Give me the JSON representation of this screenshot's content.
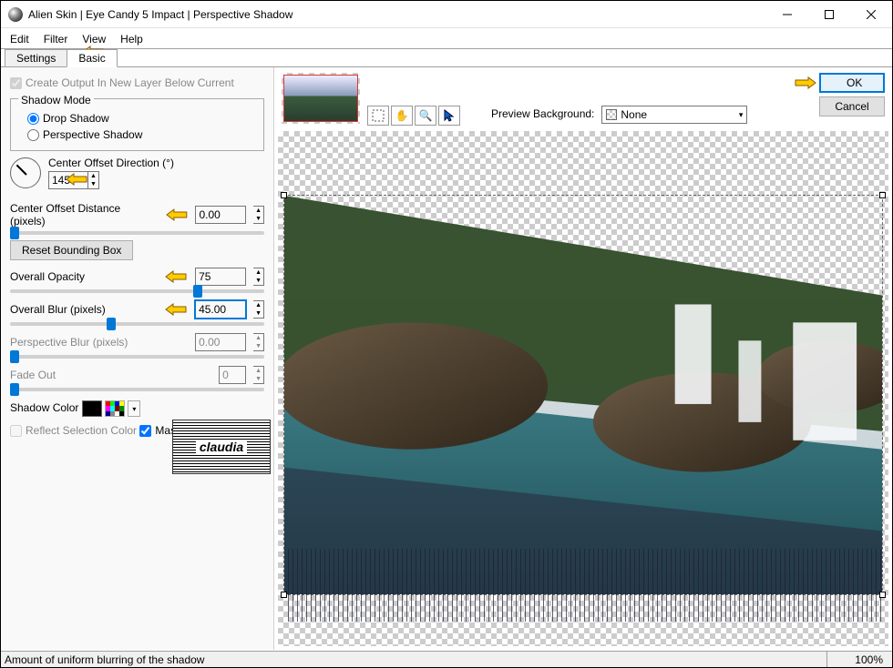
{
  "window": {
    "title": "Alien Skin | Eye Candy 5 Impact | Perspective Shadow"
  },
  "menubar": [
    "Edit",
    "Filter",
    "View",
    "Help"
  ],
  "tabs": {
    "settings": "Settings",
    "basic": "Basic"
  },
  "panel": {
    "create_output": "Create Output In New Layer Below Current",
    "shadow_mode_label": "Shadow Mode",
    "drop_shadow_label": "Drop Shadow",
    "perspective_shadow_label": "Perspective Shadow",
    "center_offset_dir_label": "Center Offset Direction (°)",
    "center_offset_dir_value": "145",
    "center_offset_dist_label": "Center Offset Distance (pixels)",
    "center_offset_dist_value": "0.00",
    "reset_bbox": "Reset Bounding Box",
    "overall_opacity_label": "Overall Opacity",
    "overall_opacity_value": "75",
    "overall_blur_label": "Overall Blur (pixels)",
    "overall_blur_value": "45.00",
    "perspective_blur_label": "Perspective Blur (pixels)",
    "perspective_blur_value": "0.00",
    "fade_out_label": "Fade Out",
    "fade_out_value": "0",
    "shadow_color_label": "Shadow Color",
    "reflect_sel_label": "Reflect Selection Color",
    "mask_sel_label": "Mask Selection",
    "stamp": "claudia"
  },
  "preview": {
    "bg_label": "Preview Background:",
    "bg_value": "None",
    "ok": "OK",
    "cancel": "Cancel"
  },
  "status": {
    "message": "Amount of uniform blurring of the shadow",
    "zoom": "100%"
  },
  "colors": {
    "accent": "#0078d7",
    "shadow_color": "#000000"
  }
}
